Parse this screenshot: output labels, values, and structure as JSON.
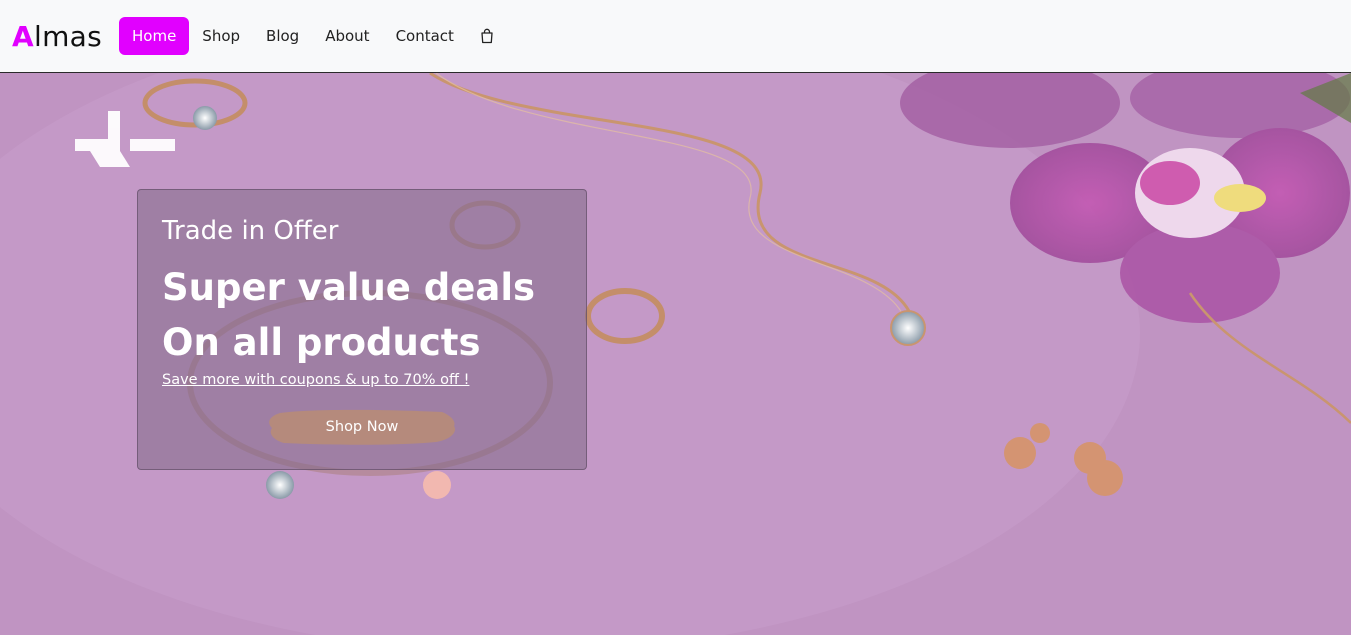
{
  "brand": {
    "accent_letter": "A",
    "rest": "lmas",
    "accent_color": "#e100ff"
  },
  "nav": {
    "items": [
      {
        "label": "Home",
        "active": true
      },
      {
        "label": "Shop",
        "active": false
      },
      {
        "label": "Blog",
        "active": false
      },
      {
        "label": "About",
        "active": false
      },
      {
        "label": "Contact",
        "active": false
      }
    ],
    "cart_icon": "shopping-bag-icon"
  },
  "hero": {
    "kicker": "Trade in Offer",
    "title_line1": "Super value deals",
    "title_line2": "On all products",
    "subtitle": "Save more with coupons & up to 70% off !",
    "cta_label": "Shop Now",
    "cta_color": "#b58a7c",
    "background_color": "#c196c4"
  }
}
